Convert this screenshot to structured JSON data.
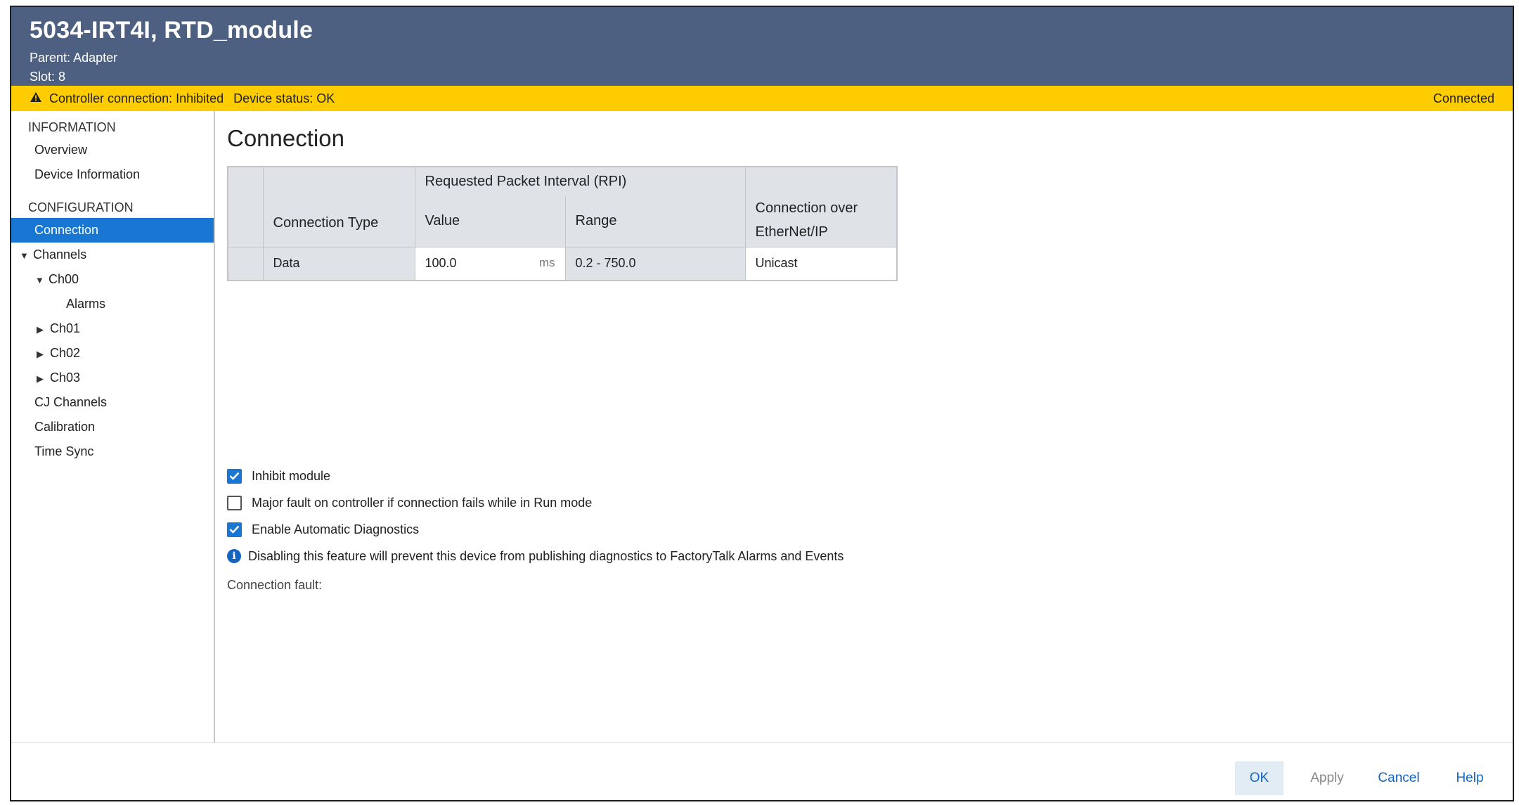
{
  "header": {
    "title": "5034-IRT4I, RTD_module",
    "parent_label": "Parent:",
    "parent_value": "Adapter",
    "slot_label": "Slot:",
    "slot_value": "8"
  },
  "status": {
    "controller_connection": "Controller connection: Inhibited",
    "device_status": "Device status: OK",
    "connected": "Connected",
    "bar_color": "#ffcc00",
    "warning_icon": "warning-triangle-icon"
  },
  "sidebar": {
    "information_label": "INFORMATION",
    "overview": "Overview",
    "device_information": "Device Information",
    "configuration_label": "CONFIGURATION",
    "connection": "Connection",
    "channels": "Channels",
    "ch00": "Ch00",
    "alarms": "Alarms",
    "ch01": "Ch01",
    "ch02": "Ch02",
    "ch03": "Ch03",
    "cj_channels": "CJ Channels",
    "calibration": "Calibration",
    "time_sync": "Time Sync",
    "selected_color": "#1976d2"
  },
  "main": {
    "title": "Connection",
    "table": {
      "header_connection_type": "Connection Type",
      "header_rpi_group": "Requested Packet Interval (RPI)",
      "header_value": "Value",
      "header_range": "Range",
      "header_conn_over": "Connection over EtherNet/IP",
      "row_type": "Data",
      "row_value": "100.0",
      "row_unit": "ms",
      "row_range": "0.2 - 750.0",
      "row_conn": "Unicast"
    },
    "options": {
      "inhibit_module": "Inhibit module",
      "inhibit_checked": true,
      "major_fault": "Major fault on controller if connection fails while in Run mode",
      "major_fault_checked": false,
      "enable_diag": "Enable Automatic Diagnostics",
      "enable_diag_checked": true,
      "info_text": "Disabling this feature will prevent this device from publishing diagnostics to FactoryTalk Alarms and Events"
    },
    "connection_fault_label": "Connection fault:"
  },
  "footer": {
    "ok": "OK",
    "apply": "Apply",
    "cancel": "Cancel",
    "help": "Help"
  },
  "colors": {
    "header_bg": "#4e6082",
    "accent": "#1976d2"
  }
}
